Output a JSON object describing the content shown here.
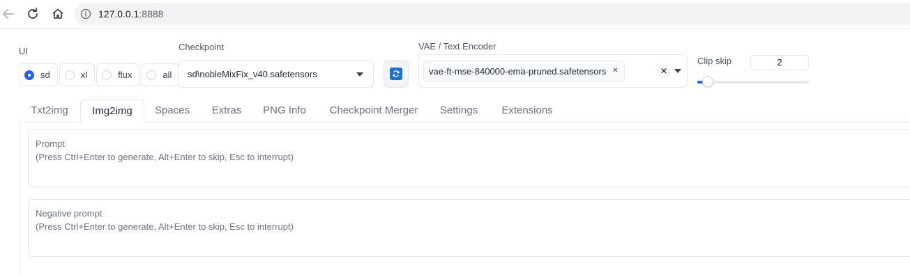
{
  "browser": {
    "url_host": "127.0.0.1",
    "url_port": ":8888"
  },
  "ui_mode": {
    "label": "UI",
    "options": [
      {
        "label": "sd",
        "selected": true
      },
      {
        "label": "xl",
        "selected": false
      },
      {
        "label": "flux",
        "selected": false
      },
      {
        "label": "all",
        "selected": false
      }
    ]
  },
  "checkpoint": {
    "label": "Checkpoint",
    "value": "sd\\nobleMixFix_v40.safetensors"
  },
  "vae": {
    "label": "VAE / Text Encoder",
    "selected": "vae-ft-mse-840000-ema-pruned.safetensors"
  },
  "clip_skip": {
    "label": "Clip skip",
    "value": "2",
    "min": 1,
    "max": 12
  },
  "tabs": [
    {
      "label": "Txt2img",
      "active": false
    },
    {
      "label": "Img2img",
      "active": true
    },
    {
      "label": "Spaces",
      "active": false
    },
    {
      "label": "Extras",
      "active": false
    },
    {
      "label": "PNG Info",
      "active": false
    },
    {
      "label": "Checkpoint Merger",
      "active": false
    },
    {
      "label": "Settings",
      "active": false
    },
    {
      "label": "Extensions",
      "active": false
    }
  ],
  "prompt": {
    "label": "Prompt",
    "hint": "(Press Ctrl+Enter to generate, Alt+Enter to skip, Esc to interrupt)"
  },
  "negative_prompt": {
    "label": "Negative prompt",
    "hint": "(Press Ctrl+Enter to generate, Alt+Enter to skip, Esc to interrupt)"
  },
  "colors": {
    "accent": "#2563eb",
    "border": "#e5e7eb"
  }
}
